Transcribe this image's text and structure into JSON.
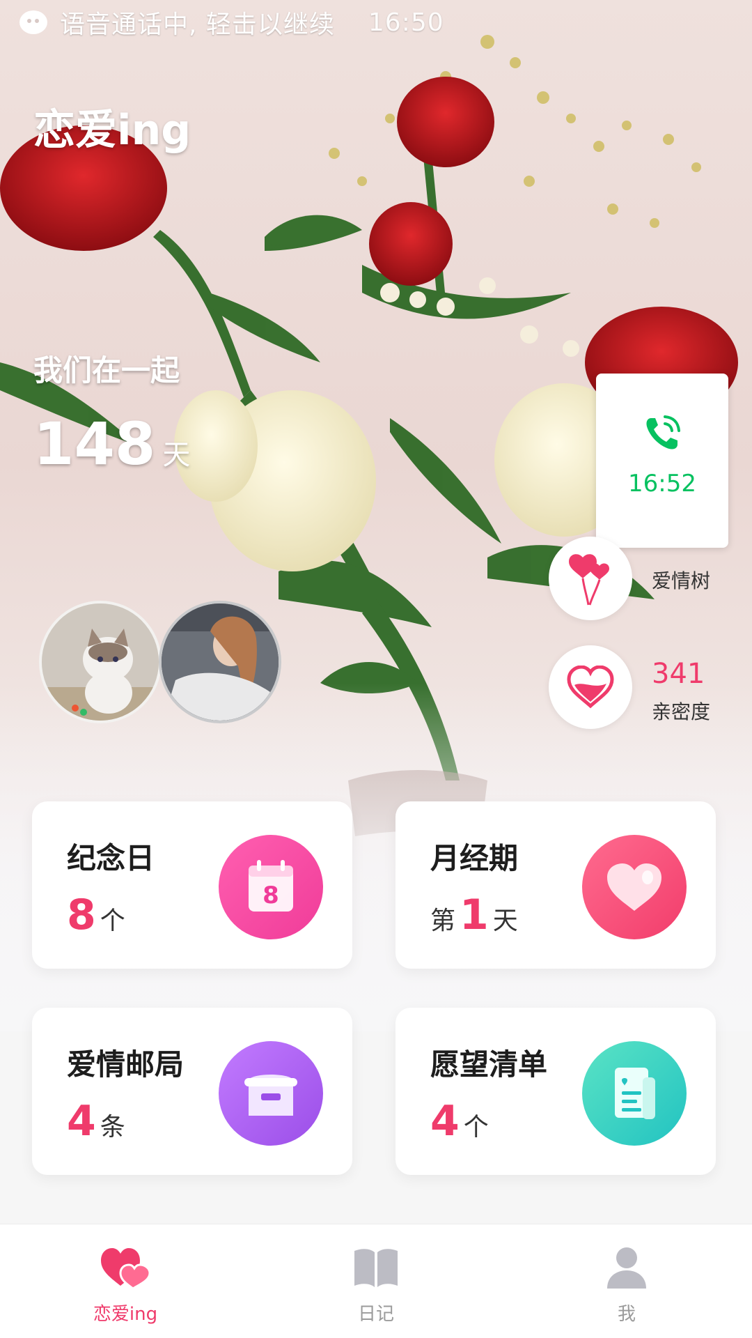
{
  "status_bar": {
    "call_text": "语音通话中, 轻击以继续",
    "time": "16:50"
  },
  "app": {
    "title": "恋爱ing"
  },
  "together": {
    "label": "我们在一起",
    "days": "148",
    "unit": "天"
  },
  "call_widget": {
    "time": "16:52"
  },
  "love_tree": {
    "label": "爱情树"
  },
  "intimacy": {
    "value": "341",
    "label": "亲密度"
  },
  "cards": [
    {
      "title": "纪念日",
      "prefix": "",
      "value": "8",
      "unit": "个",
      "icon": "calendar-icon",
      "icon_text": "8"
    },
    {
      "title": "月经期",
      "prefix": "第",
      "value": "1",
      "unit": "天",
      "icon": "heart-icon"
    },
    {
      "title": "爱情邮局",
      "prefix": "",
      "value": "4",
      "unit": "条",
      "icon": "mailbox-icon"
    },
    {
      "title": "愿望清单",
      "prefix": "",
      "value": "4",
      "unit": "个",
      "icon": "receipt-icon"
    }
  ],
  "tabs": [
    {
      "label": "恋爱ing",
      "icon": "hearts-icon",
      "active": true
    },
    {
      "label": "日记",
      "icon": "book-icon",
      "active": false
    },
    {
      "label": "我",
      "icon": "person-icon",
      "active": false
    }
  ],
  "colors": {
    "accent": "#ef3b6b",
    "call_green": "#07c160",
    "inactive": "#9b9b9b"
  }
}
